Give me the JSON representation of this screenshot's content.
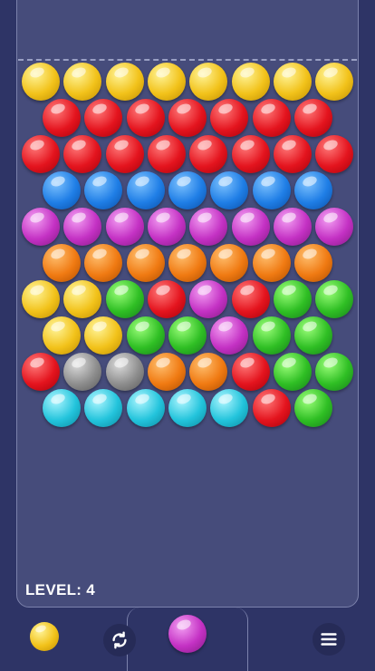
{
  "level": {
    "text": "LEVEL: 4",
    "value": 4
  },
  "palette": {
    "Y": [
      "#fff59a",
      "#f2c21a",
      "#c08e00"
    ],
    "R": [
      "#ff7a7a",
      "#e4141e",
      "#a8000a"
    ],
    "B": [
      "#7fc3ff",
      "#1f7ee6",
      "#0a4fa8"
    ],
    "P": [
      "#f3a0f3",
      "#c431c4",
      "#861a86"
    ],
    "O": [
      "#ffc070",
      "#f07a12",
      "#b04e00"
    ],
    "G": [
      "#9cff7a",
      "#2fbf24",
      "#16801a"
    ],
    "K": [
      "#dcdcdc",
      "#8e8e8e",
      "#5a5a5a"
    ],
    "C": [
      "#aef6ff",
      "#23c4dc",
      "#0a8aa0"
    ]
  },
  "grid_rows": [
    [
      "Y",
      "Y",
      "Y",
      "Y",
      "Y",
      "Y",
      "Y",
      "Y"
    ],
    [
      "R",
      "R",
      "R",
      "R",
      "R",
      "R",
      "R"
    ],
    [
      "R",
      "R",
      "R",
      "R",
      "R",
      "R",
      "R",
      "R"
    ],
    [
      "B",
      "B",
      "B",
      "B",
      "B",
      "B",
      "B"
    ],
    [
      "P",
      "P",
      "P",
      "P",
      "P",
      "P",
      "P",
      "P"
    ],
    [
      "O",
      "O",
      "O",
      "O",
      "O",
      "O",
      "O"
    ],
    [
      "Y",
      "Y",
      "G",
      "R",
      "P",
      "R",
      "G",
      "G"
    ],
    [
      "Y",
      "Y",
      "G",
      "G",
      "P",
      "G",
      "G"
    ],
    [
      "R",
      "K",
      "K",
      "O",
      "O",
      "R",
      "G",
      "G"
    ],
    [
      "C",
      "C",
      "C",
      "C",
      "C",
      "R",
      "G"
    ]
  ],
  "next_bubble": {
    "color": "Y"
  },
  "current_bubble": {
    "color": "P"
  },
  "icons": {
    "swap": "refresh-icon",
    "menu": "menu-icon"
  }
}
